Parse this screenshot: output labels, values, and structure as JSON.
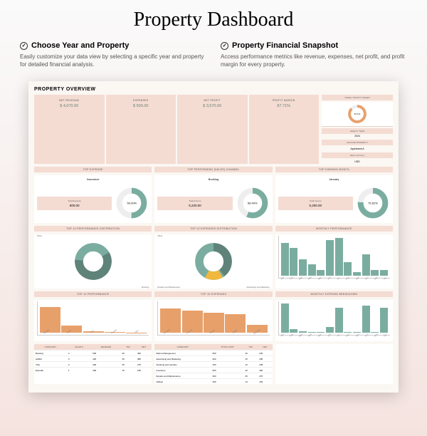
{
  "title": "Property Dashboard",
  "features": [
    {
      "h": "Choose Year and Property",
      "d": "Easily customize your data view by selecting a specific year and property for detailed financial analysis."
    },
    {
      "h": "Property Financial Snapshot",
      "d": "Access performance metrics like revenue, expenses, net profit, and profit margin for every property."
    }
  ],
  "dash": {
    "title": "PROPERTY OVERVIEW",
    "kpi": [
      {
        "l": "NET REVENUE",
        "v": "$ 4,070.00"
      },
      {
        "l": "EXPENSES",
        "v": "$ 500.00"
      },
      {
        "l": "NET PROFIT",
        "v": "$ 3,570.00"
      },
      {
        "l": "PROFIT MARGIN",
        "v": "87.71%"
      }
    ],
    "right": {
      "target_h": "YEARLY PROFIT TARGET",
      "target_v": "87.1%",
      "year_h": "SELECT YEAR",
      "year_v": "2024",
      "prop_h": "CHOOSE PROPERTY",
      "prop_v": "Apartment A",
      "cur_h": "Base Currency",
      "cur_v": "USD"
    },
    "sec_headers": {
      "top_expense": "TOP EXPENSE",
      "top_channel": "TOP PERFORMING (SALES) CHANNEL",
      "top_month": "TOP EARNING MONTH"
    },
    "cards": [
      {
        "title": "Insurance",
        "box_l": "Total Expense",
        "box_v": "500.00",
        "pct": "50.00%"
      },
      {
        "title": "Booking",
        "box_l": "Total Income",
        "box_v": "5,220.00",
        "pct": "56.49%"
      },
      {
        "title": "January",
        "box_l": "Total Income",
        "box_v": "5,200.00",
        "pct": "75.62%"
      }
    ],
    "distribution": {
      "h1": "TOP 10 PERFORMANCE DISTRIBUTION",
      "l1a": "Other",
      "l1b": "Booking",
      "h2": "TOP 10 EXPENSES DISTRIBUTION",
      "l2a": "Other",
      "l2b": "Repairs and Maintenance",
      "l2c": "Advertising and Marketing",
      "h3": "MONTHLY PERFORMANCE"
    },
    "bottom": {
      "h1": "TOP 10 PERFORMANCE",
      "h2": "TOP 10 EXPENSES",
      "h3": "MONTHLY EXPENSE BREAKDOWN"
    },
    "table1": {
      "headers": [
        "CATEGORY",
        "NIGHTS",
        "REVENUE",
        "TAX",
        "NET"
      ]
    },
    "table2": {
      "headers": [
        "CATEGORY",
        "TOTAL COST",
        "TAX",
        "NET"
      ]
    }
  },
  "chart_data": {
    "kpi": {
      "net_revenue": 4070,
      "expenses": 500,
      "net_profit": 3570,
      "profit_margin_pct": 87.71
    },
    "yearly_target_pct": 87.1,
    "top_expense_donut": {
      "type": "pie",
      "title": "Top Expense: Insurance",
      "pct": 50.0,
      "total": 500.0
    },
    "top_channel_donut": {
      "type": "pie",
      "title": "Top Channel: Booking",
      "pct": 56.49,
      "total": 5220.0
    },
    "top_month_donut": {
      "type": "pie",
      "title": "Top Month: January",
      "pct": 75.62,
      "total": 5200.0
    },
    "performance_distribution": {
      "type": "pie",
      "series": [
        {
          "name": "Booking",
          "value": 60
        },
        {
          "name": "Other",
          "value": 40
        }
      ]
    },
    "expense_distribution": {
      "type": "pie",
      "series": [
        {
          "name": "Repairs and Maintenance",
          "value": 45
        },
        {
          "name": "Advertising and Marketing",
          "value": 15
        },
        {
          "name": "Other",
          "value": 40
        }
      ]
    },
    "monthly_performance": {
      "type": "bar",
      "categories": [
        "JAN",
        "FEB",
        "MAR",
        "APR",
        "MAY",
        "JUN",
        "JUL",
        "AUG",
        "SEP",
        "OCT",
        "NOV",
        "DEC"
      ],
      "values": [
        350,
        300,
        180,
        120,
        60,
        380,
        400,
        150,
        40,
        230,
        60,
        60
      ],
      "ylim": [
        0,
        400
      ]
    },
    "top10_performance": {
      "type": "bar",
      "categories": [
        "Booking",
        "AirBnb",
        "Vrbo",
        "Expedia",
        "Other"
      ],
      "values": [
        5300,
        1500,
        300,
        250,
        100
      ],
      "ylim": [
        0,
        6000
      ]
    },
    "top10_expenses": {
      "type": "bar",
      "categories": [
        "Insurance",
        "Cleaning",
        "Repairs",
        "Utilities",
        "Marketing"
      ],
      "values": [
        250,
        230,
        210,
        190,
        80
      ],
      "ylim": [
        0,
        300
      ]
    },
    "monthly_expense_breakdown": {
      "type": "bar",
      "categories": [
        "JAN",
        "FEB",
        "MAR",
        "APR",
        "MAY",
        "JUN",
        "JUL",
        "AUG",
        "SEP",
        "OCT",
        "NOV",
        "DEC"
      ],
      "values": [
        150,
        20,
        10,
        5,
        5,
        30,
        130,
        5,
        5,
        140,
        5,
        130
      ],
      "ylim": [
        0,
        150
      ]
    },
    "table_performance": {
      "type": "table",
      "headers": [
        "CATEGORY",
        "NIGHTS",
        "REVENUE",
        "TAX",
        "NET"
      ],
      "rows": [
        [
          "Booking",
          4,
          500,
          40,
          460
        ],
        [
          "AirBnb",
          3,
          420,
          35,
          385
        ],
        [
          "Vrbo",
          2,
          300,
          25,
          275
        ],
        [
          "Expedia",
          1,
          180,
          15,
          165
        ]
      ]
    },
    "table_expenses": {
      "type": "table",
      "headers": [
        "CATEGORY",
        "TOTAL COST",
        "TAX",
        "NET"
      ],
      "rows": [
        [
          "Marina Management",
          250,
          20,
          230
        ],
        [
          "Advertising and Marketing",
          200,
          15,
          185
        ],
        [
          "Cleaning and Laundry",
          150,
          12,
          138
        ],
        [
          "Insurance",
          500,
          40,
          460
        ],
        [
          "Repairs and Maintenance",
          300,
          25,
          275
        ],
        [
          "Utilities",
          180,
          14,
          166
        ]
      ]
    }
  }
}
